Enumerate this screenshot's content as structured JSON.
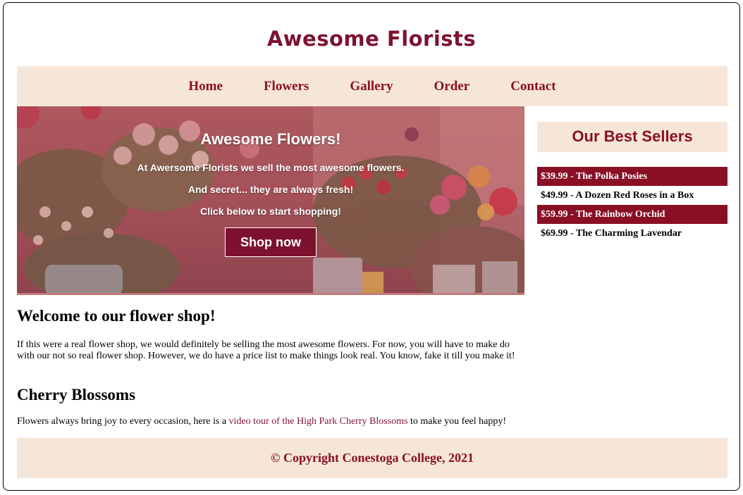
{
  "site": {
    "title": "Awesome Florists"
  },
  "nav": {
    "items": [
      "Home",
      "Flowers",
      "Gallery",
      "Order",
      "Contact"
    ]
  },
  "hero": {
    "heading": "Awesome Flowers!",
    "line1": "At Awersome Florists we sell the most awesome flowers.",
    "line2": "And secret... they are always fresh!",
    "line3": "Click below to start shopping!",
    "button": "Shop now"
  },
  "welcome": {
    "heading": "Welcome to our flower shop!",
    "body": "If this were a real flower shop, we would definitely be selling the most awesome flowers. For now, you will have to make do with our not so real flower shop. However, we do have a price list to make things look real. You know, fake it till you make it!"
  },
  "cherry": {
    "heading": "Cherry Blossoms",
    "before": "Flowers always bring joy to every occasion, here is a ",
    "link": "video tour of the High Park Cherry Blossoms",
    "after": " to make you feel happy!"
  },
  "sidebar": {
    "title": "Our Best Sellers",
    "items": [
      "$39.99 - The Polka Posies",
      "$49.99 - A Dozen Red Roses in a Box",
      "$59.99 - The Rainbow Orchid",
      "$69.99 - The Charming Lavendar"
    ]
  },
  "footer": {
    "text": "© Copyright Conestoga College, 2021"
  },
  "colors": {
    "brand": "#7d1230",
    "accent": "#8a0f25",
    "panel": "#f6e6da"
  }
}
